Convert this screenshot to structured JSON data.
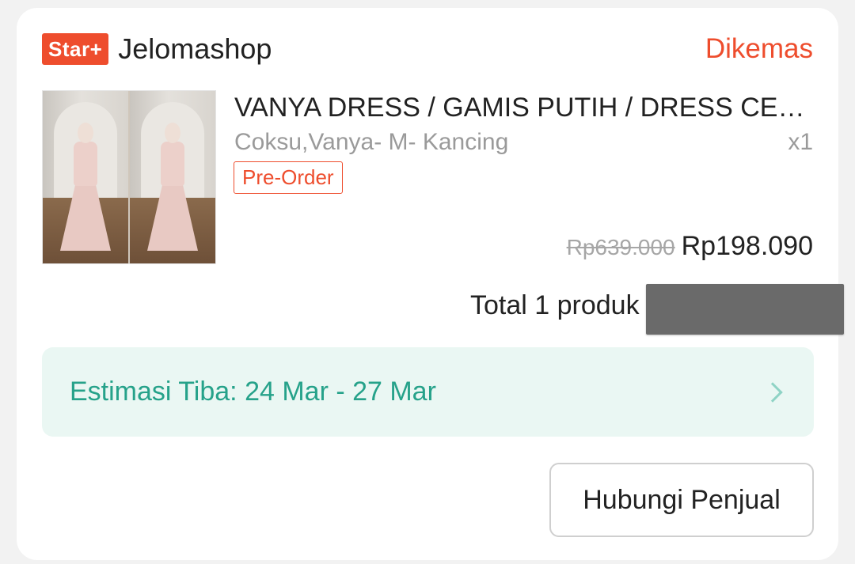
{
  "shop": {
    "badge": "Star+",
    "name": "Jelomashop",
    "status": "Dikemas"
  },
  "product": {
    "title": "VANYA DRESS / GAMIS PUTIH / DRESS CE…",
    "variant": "Coksu,Vanya- M- Kancing",
    "quantity": "x1",
    "tag": "Pre-Order",
    "price_original": "Rp639.000",
    "price_final": "Rp198.090"
  },
  "summary": {
    "total_label": "Total 1 produk"
  },
  "estimate": {
    "text": "Estimasi Tiba: 24 Mar - 27 Mar"
  },
  "actions": {
    "contact_seller": "Hubungi Penjual"
  },
  "colors": {
    "accent": "#ee4d2d",
    "estimate_text": "#26a28a",
    "estimate_bg": "#eaf7f3"
  }
}
